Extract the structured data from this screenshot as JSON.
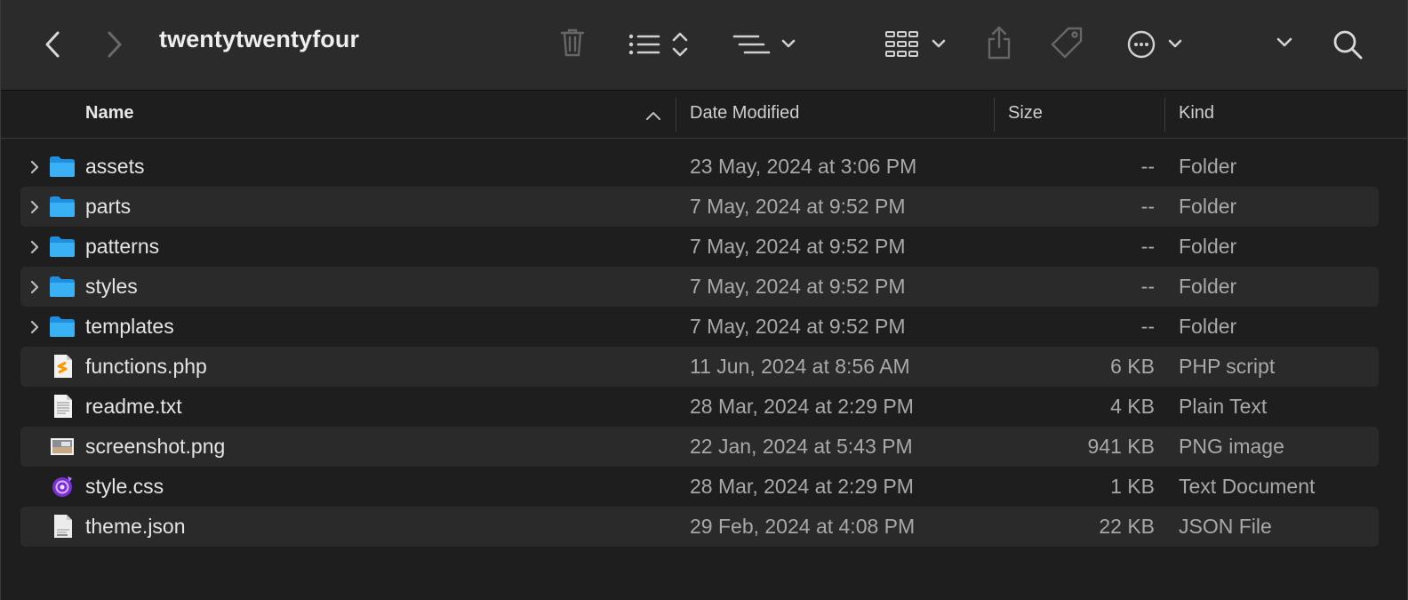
{
  "window": {
    "title": "twentytwentyfour"
  },
  "toolbar": {
    "icons": [
      "back-icon",
      "forward-icon",
      "trash-icon",
      "list-view-icon",
      "group-icon",
      "grid-view-icon",
      "share-icon",
      "tag-icon",
      "more-icon",
      "chevron-down-icon",
      "search-icon"
    ]
  },
  "columns": {
    "name": "Name",
    "date": "Date Modified",
    "size": "Size",
    "kind": "Kind"
  },
  "rows": [
    {
      "name": "assets",
      "date": "23 May, 2024 at 3:06 PM",
      "size": "--",
      "kind": "Folder",
      "icon": "folder-icon",
      "expandable": true
    },
    {
      "name": "parts",
      "date": "7 May, 2024 at 9:52 PM",
      "size": "--",
      "kind": "Folder",
      "icon": "folder-icon",
      "expandable": true
    },
    {
      "name": "patterns",
      "date": "7 May, 2024 at 9:52 PM",
      "size": "--",
      "kind": "Folder",
      "icon": "folder-icon",
      "expandable": true
    },
    {
      "name": "styles",
      "date": "7 May, 2024 at 9:52 PM",
      "size": "--",
      "kind": "Folder",
      "icon": "folder-icon",
      "expandable": true
    },
    {
      "name": "templates",
      "date": "7 May, 2024 at 9:52 PM",
      "size": "--",
      "kind": "Folder",
      "icon": "folder-icon",
      "expandable": true
    },
    {
      "name": "functions.php",
      "date": "11 Jun, 2024 at 8:56 AM",
      "size": "6 KB",
      "kind": "PHP script",
      "icon": "php-file-icon",
      "expandable": false
    },
    {
      "name": "readme.txt",
      "date": "28 Mar, 2024 at 2:29 PM",
      "size": "4 KB",
      "kind": "Plain Text",
      "icon": "text-file-icon",
      "expandable": false
    },
    {
      "name": "screenshot.png",
      "date": "22 Jan, 2024 at 5:43 PM",
      "size": "941 KB",
      "kind": "PNG image",
      "icon": "image-file-icon",
      "expandable": false
    },
    {
      "name": "style.css",
      "date": "28 Mar, 2024 at 2:29 PM",
      "size": "1 KB",
      "kind": "Text Document",
      "icon": "css-file-icon",
      "expandable": false
    },
    {
      "name": "theme.json",
      "date": "29 Feb, 2024 at 4:08 PM",
      "size": "22 KB",
      "kind": "JSON File",
      "icon": "json-file-icon",
      "expandable": false
    }
  ]
}
